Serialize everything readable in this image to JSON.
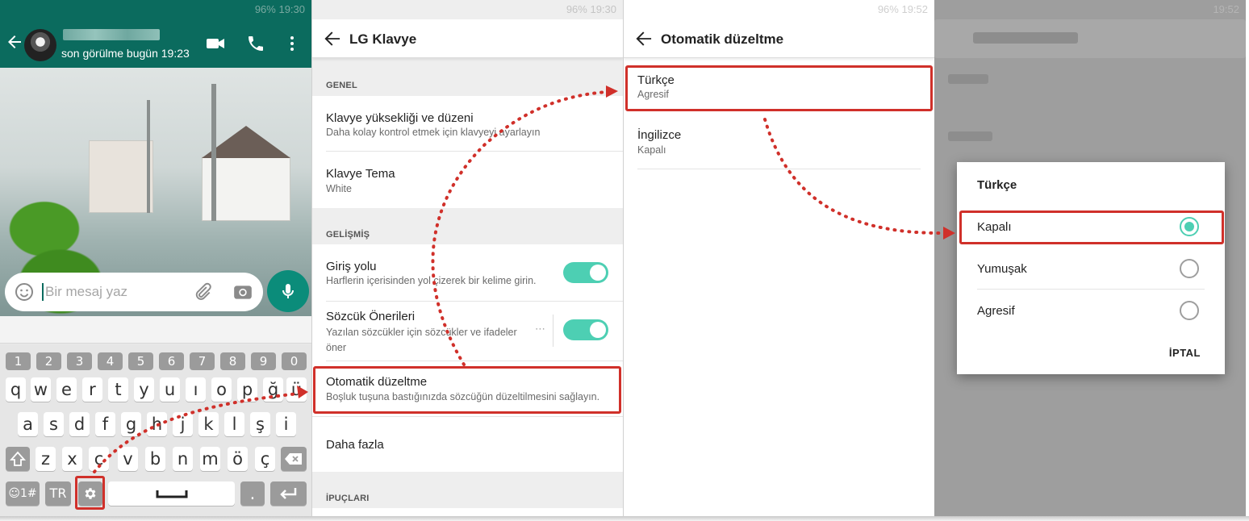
{
  "colors": {
    "whatsapp_green": "#0b6b5e",
    "accent_teal": "#4dcfb3",
    "highlight_red": "#d0302a"
  },
  "panel1": {
    "status_text": "96% 19:30",
    "last_seen": "son görülme bugün 19:23",
    "message_placeholder": "Bir mesaj yaz",
    "keyboard": {
      "numbers": [
        "1",
        "2",
        "3",
        "4",
        "5",
        "6",
        "7",
        "8",
        "9",
        "0"
      ],
      "row1": [
        "q",
        "w",
        "e",
        "r",
        "t",
        "y",
        "u",
        "ı",
        "o",
        "p",
        "ğ",
        "ü"
      ],
      "row2": [
        "a",
        "s",
        "d",
        "f",
        "g",
        "h",
        "j",
        "k",
        "l",
        "ş",
        "i"
      ],
      "row3": [
        "z",
        "x",
        "c",
        "v",
        "b",
        "n",
        "m",
        "ö",
        "ç"
      ],
      "symbols_key": "☺1#",
      "language_key": "TR",
      "period_key": "."
    }
  },
  "panel2": {
    "status_text": "96% 19:30",
    "title": "LG Klavye",
    "section_general": "GENEL",
    "item_height_title": "Klavye yüksekliği ve düzeni",
    "item_height_sub": "Daha kolay kontrol etmek için klavyeyi ayarlayın",
    "item_theme_title": "Klavye Tema",
    "item_theme_sub": "White",
    "section_advanced": "GELİŞMİŞ",
    "item_path_title": "Giriş yolu",
    "item_path_sub": "Harflerin içerisinden yol çizerek bir kelime girin.",
    "item_suggest_title": "Sözcük Önerileri",
    "item_suggest_sub": "Yazılan sözcükler için sözcükler ve ifadeler öner",
    "item_autocorrect_title": "Otomatik düzeltme",
    "item_autocorrect_sub": "Boşluk tuşuna bastığınızda sözcüğün düzeltilmesini sağlayın.",
    "item_more_title": "Daha fazla",
    "section_tips": "İPUÇLARI"
  },
  "panel3": {
    "status_text": "96% 19:52",
    "title": "Otomatik düzeltme",
    "lang1_title": "Türkçe",
    "lang1_sub": "Agresif",
    "lang2_title": "İngilizce",
    "lang2_sub": "Kapalı"
  },
  "panel4": {
    "status_text": "19:52",
    "dialog_title": "Türkçe",
    "options": [
      "Kapalı",
      "Yumuşak",
      "Agresif"
    ],
    "selected_option": "Kapalı",
    "cancel_label": "İPTAL"
  }
}
